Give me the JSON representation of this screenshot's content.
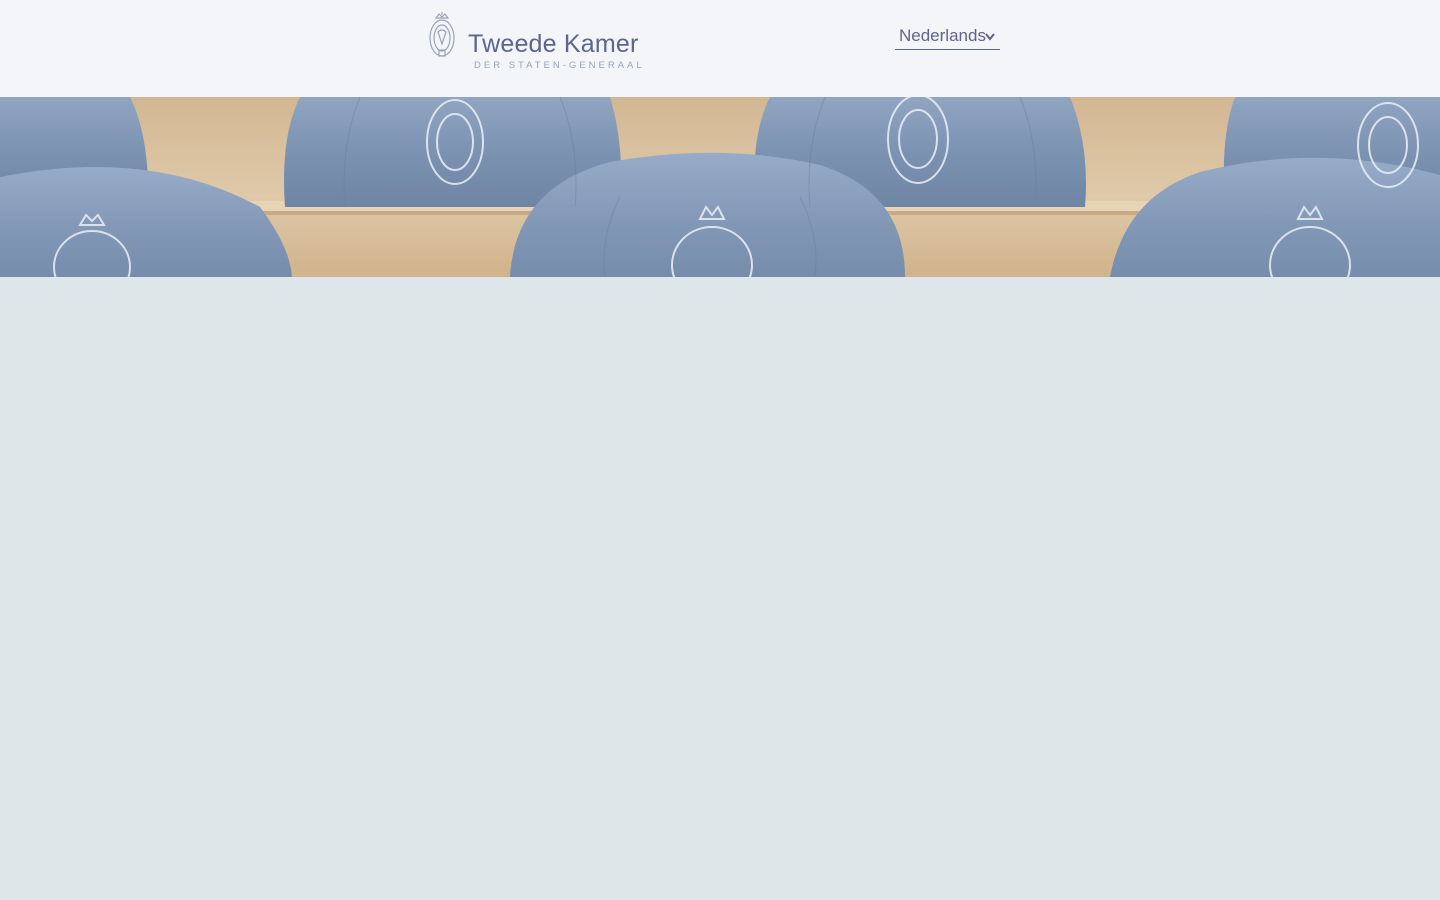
{
  "header": {
    "logo": {
      "name": "Tweede Kamer",
      "subtitle": "DER STATEN-GENERAAL",
      "icon": "royal-crest-icon"
    },
    "language_selector": {
      "value": "Nederlands",
      "icon": "chevron-down-icon"
    }
  },
  "hero": {
    "image": "blue-leather-parliament-chairs-with-crest"
  },
  "colors": {
    "header_bg": "#f3f5f8",
    "brand_text": "#5b6590",
    "page_bg": "#dfe6ea"
  }
}
